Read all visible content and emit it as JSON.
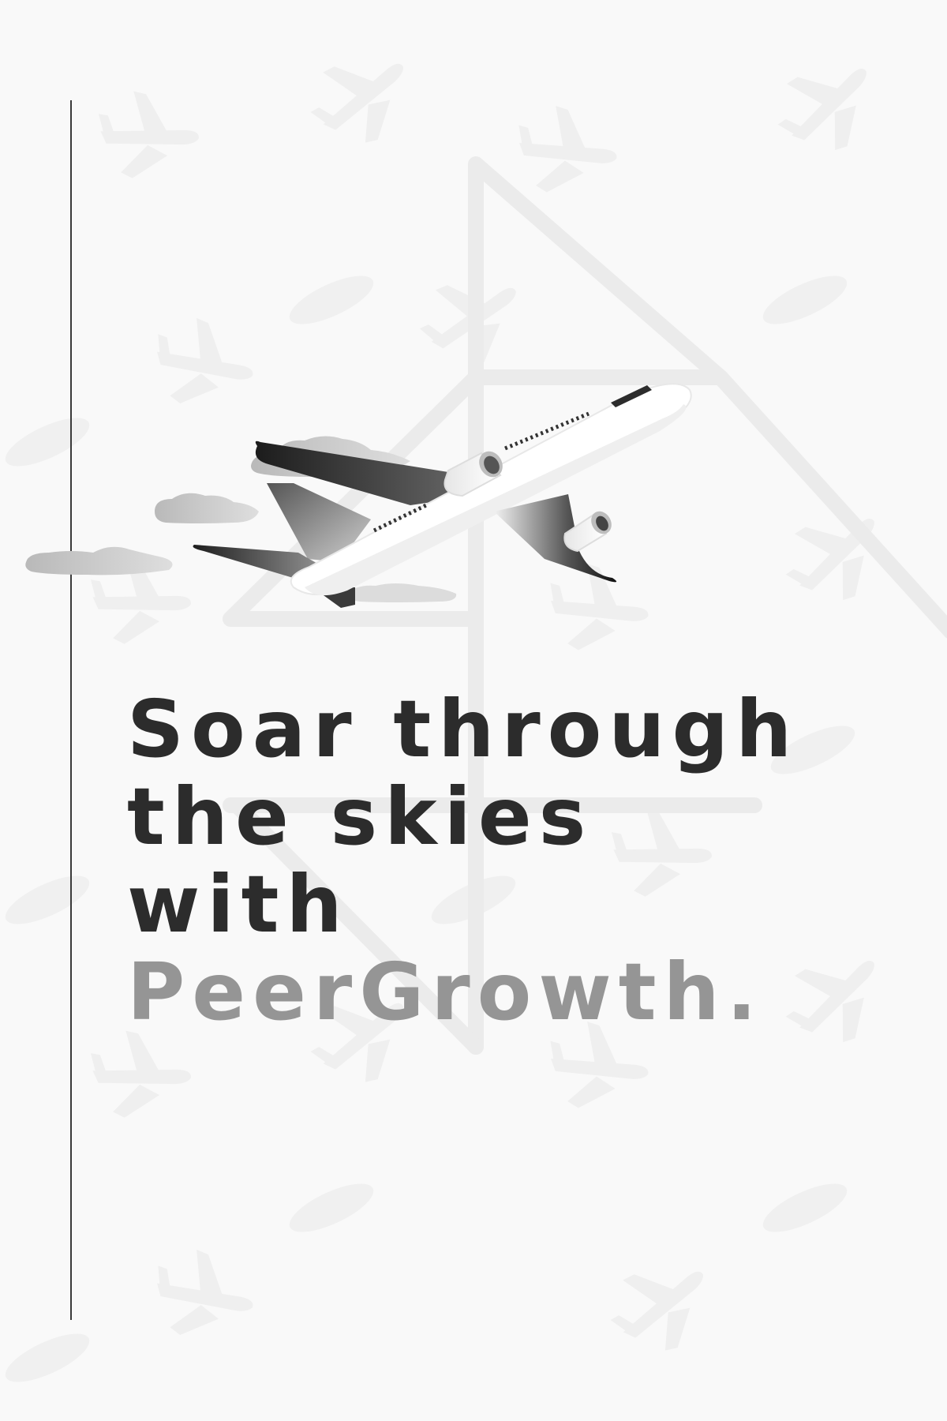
{
  "headline": {
    "line1": "Soar through",
    "line2": "the skies",
    "line3": "with",
    "brand": "PeerGrowth."
  },
  "colors": {
    "background": "#f9f9f9",
    "headline_text": "#2c2c2c",
    "brand_text": "#959595",
    "watermark": "#ececec"
  },
  "icons": {
    "hero": "airplane-takeoff-illustration",
    "background": "airplane-pattern",
    "watermark": "logo-watermark"
  }
}
